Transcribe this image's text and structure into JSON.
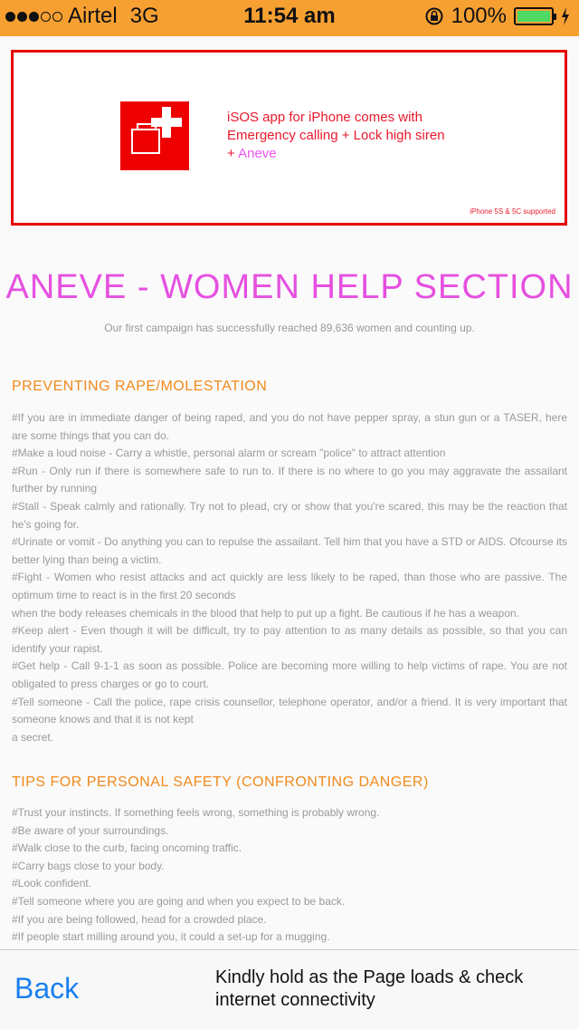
{
  "status_bar": {
    "carrier": "Airtel",
    "network": "3G",
    "time": "11:54 am",
    "battery": "100%",
    "signal_bars_filled": 3,
    "signal_bars_total": 5,
    "battery_level": 1.0,
    "battery_color": "#4cd964",
    "icons": [
      "rotation-lock-icon",
      "battery-icon",
      "charging-bolt-icon"
    ]
  },
  "ad": {
    "line1": "iSOS app for iPhone comes with",
    "line2": "Emergency calling + Lock high siren",
    "line3_prefix": "+ ",
    "line3_brand": "Aneve",
    "note": "iPhone 5S & 5C supported",
    "icon": "isos-app-icon",
    "border_color": "#e60000"
  },
  "header": {
    "title": "ANEVE - WOMEN HELP SECTION",
    "subtitle": "Our first campaign has successfully reached 89,636 women and counting up.",
    "title_color": "#e64fe0"
  },
  "sections": [
    {
      "heading": "PREVENTING RAPE/MOLESTATION",
      "lines": [
        "#If you are in immediate danger of being raped, and you do not have pepper spray, a stun gun or a TASER, here are some things that you can do.",
        "#Make a loud noise - Carry a whistle, personal alarm or scream \"police\" to attract attention",
        "#Run - Only run if there is somewhere safe to run to. If there is no where to go you may aggravate the assailant further by running",
        "#Stall - Speak calmly and rationally. Try not to plead, cry or show that you're scared, this may be the reaction that he's going for.",
        "#Urinate or vomit - Do anything you can to repulse the assailant. Tell him that you have a STD or AIDS. Ofcourse its better lying than being a victim.",
        "#Fight - Women who resist attacks and act quickly are less likely to be raped, than those who are passive. The optimum time to react is in the first 20 seconds",
        "when the body releases chemicals in the blood that help to put up a fight. Be cautious if he has a weapon.",
        "#Keep alert - Even though it will be difficult, try to pay attention to as many details as possible, so that you can identify your rapist.",
        "#Get help - Call 9-1-1 as soon as possible. Police are becoming more willing to help victims of rape. You are not obligated to press charges or go to court.",
        "#Tell someone - Call the police, rape crisis counsellor, telephone operator, and/or a friend. It is very important that someone knows and that it is not kept",
        "a secret."
      ]
    },
    {
      "heading": "TIPS FOR PERSONAL SAFETY (CONFRONTING DANGER)",
      "lines": [
        "#Trust your instincts. If something feels wrong, something is probably wrong.",
        "#Be aware of your surroundings.",
        "#Walk close to the curb, facing oncoming traffic.",
        "#Carry bags close to your body.",
        "#Look confident.",
        "#Tell someone where you are going and when you expect to be back.",
        "#If you are being followed, head for a crowded place.",
        "#If people start milling around you, it could a set-up for a mugging."
      ]
    }
  ],
  "bottom_bar": {
    "back_label": "Back",
    "message": "Kindly hold as the Page loads & check internet connectivity",
    "back_color": "#1a7ff0"
  }
}
